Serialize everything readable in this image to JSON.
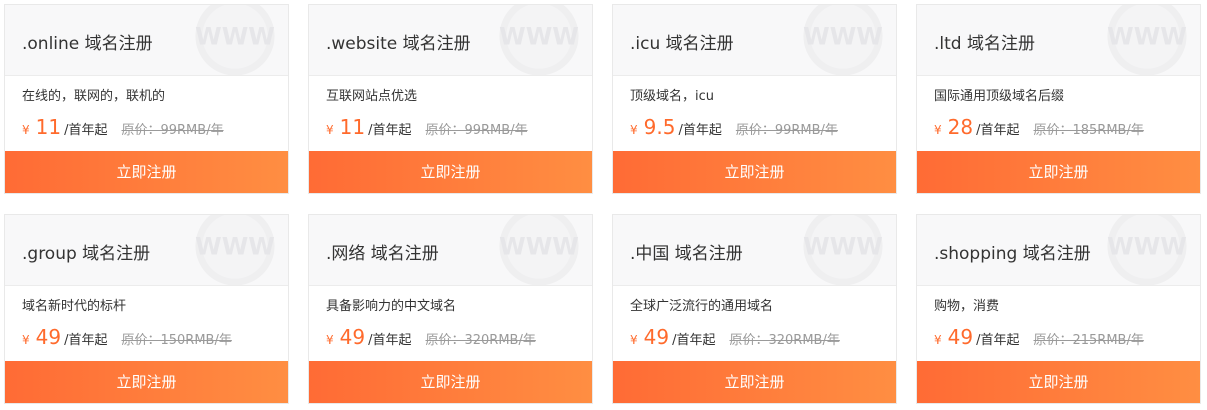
{
  "domains": [
    {
      "title": ".online 域名注册",
      "desc": "在线的，联网的，联机的",
      "yen": "¥",
      "price": "11",
      "unit": "/首年起",
      "original": "原价：99RMB/年",
      "button": "立即注册"
    },
    {
      "title": ".website 域名注册",
      "desc": "互联网站点优选",
      "yen": "¥",
      "price": "11",
      "unit": "/首年起",
      "original": "原价：99RMB/年",
      "button": "立即注册"
    },
    {
      "title": ".icu 域名注册",
      "desc": "顶级域名，icu",
      "yen": "¥",
      "price": "9.5",
      "unit": "/首年起",
      "original": "原价：99RMB/年",
      "button": "立即注册"
    },
    {
      "title": ".ltd 域名注册",
      "desc": "国际通用顶级域名后缀",
      "yen": "¥",
      "price": "28",
      "unit": "/首年起",
      "original": "原价：185RMB/年",
      "button": "立即注册"
    },
    {
      "title": ".group 域名注册",
      "desc": "域名新时代的标杆",
      "yen": "¥",
      "price": "49",
      "unit": "/首年起",
      "original": "原价：150RMB/年",
      "button": "立即注册"
    },
    {
      "title": ".网络 域名注册",
      "desc": "具备影响力的中文域名",
      "yen": "¥",
      "price": "49",
      "unit": "/首年起",
      "original": "原价：320RMB/年",
      "button": "立即注册"
    },
    {
      "title": ".中国 域名注册",
      "desc": "全球广泛流行的通用域名",
      "yen": "¥",
      "price": "49",
      "unit": "/首年起",
      "original": "原价：320RMB/年",
      "button": "立即注册"
    },
    {
      "title": ".shopping 域名注册",
      "desc": "购物，消费",
      "yen": "¥",
      "price": "49",
      "unit": "/首年起",
      "original": "原价：215RMB/年",
      "button": "立即注册"
    }
  ],
  "colors": {
    "accent": "#ff6a2c",
    "button_start": "#ff6b35",
    "button_end": "#ff8e42"
  }
}
